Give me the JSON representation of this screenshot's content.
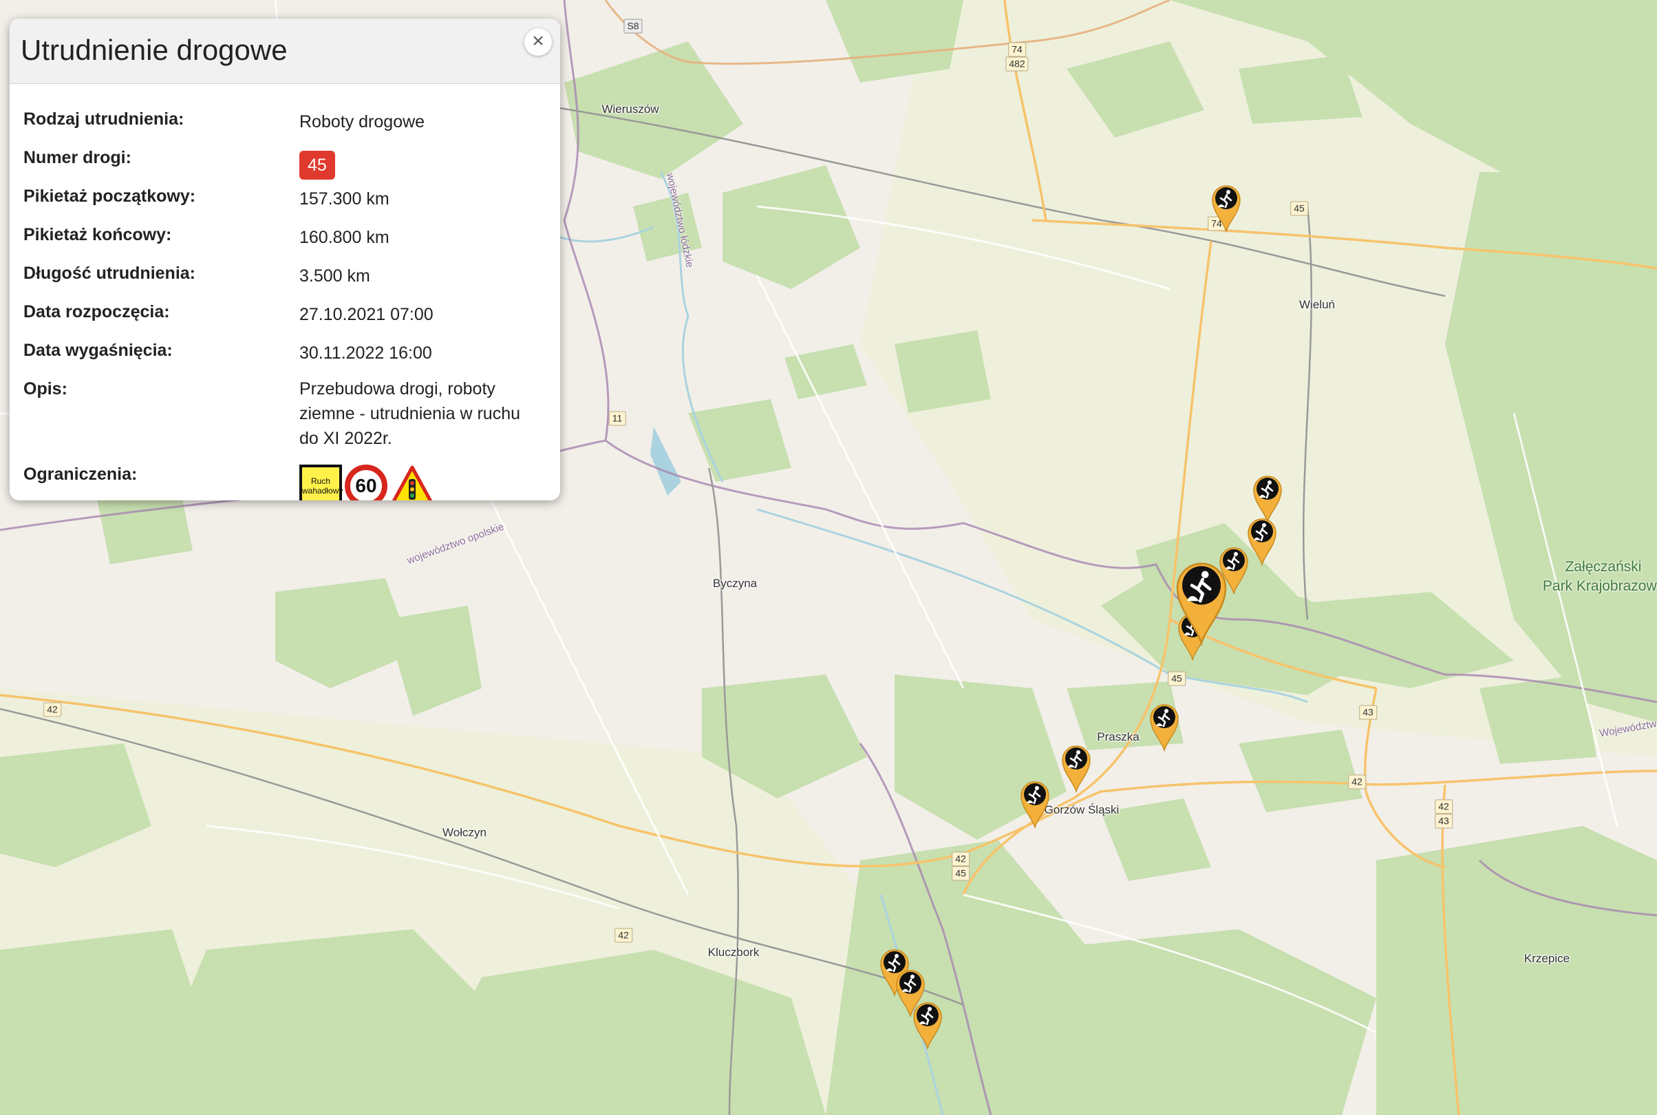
{
  "popup": {
    "title": "Utrudnienie drogowe",
    "close_label": "×",
    "rows": [
      {
        "label": "Rodzaj utrudnienia:",
        "value": "Roboty drogowe"
      },
      {
        "label": "Numer drogi:",
        "value": "45"
      },
      {
        "label": "Pikietaż początkowy:",
        "value": "157.300 km"
      },
      {
        "label": "Pikietaż końcowy:",
        "value": "160.800 km"
      },
      {
        "label": "Długość utrudnienia:",
        "value": "3.500 km"
      },
      {
        "label": "Data rozpoczęcia:",
        "value": "27.10.2021 07:00"
      },
      {
        "label": "Data wygaśnięcia:",
        "value": "30.11.2022 16:00"
      },
      {
        "label": "Opis:",
        "value": "Przebudowa drogi, roboty ziemne - utrudnienia w ruchu do XI 2022r."
      },
      {
        "label": "Ograniczenia:",
        "value": ""
      }
    ],
    "signs": {
      "ruch_line1": "Ruch",
      "ruch_line2": "wahadłowy",
      "speed_limit": "60"
    },
    "colors": {
      "road_badge": "#e03a2f",
      "sign_yellow": "#fff14a",
      "sign_red": "#d7261c"
    }
  },
  "map": {
    "places": [
      "Wieruszów",
      "Wieluń",
      "Byczyna",
      "Praszka",
      "Gorzów Śląski",
      "Wołczyn",
      "Kluczbork",
      "Krzepice"
    ],
    "park": [
      "Załęczański",
      "Park Krajobrazowy"
    ],
    "regions": [
      "województwo łódzkie",
      "województwo opolskie",
      "Województwo"
    ],
    "road_shields": [
      "S8",
      "74",
      "482",
      "74",
      "45",
      "11",
      "45",
      "42",
      "43",
      "42",
      "42",
      "43",
      "42",
      "45",
      "42"
    ],
    "marker_icon": "roadworks-icon",
    "colors": {
      "marker": "#f3b13c",
      "marker_icon_bg": "#111111",
      "forest": "#c8dfb0",
      "road": "#f9c873"
    }
  }
}
